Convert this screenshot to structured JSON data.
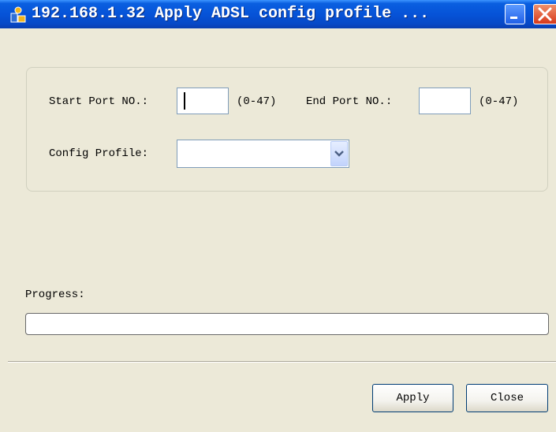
{
  "window": {
    "title": "192.168.1.32 Apply ADSL config profile ...",
    "icon": "app-icon",
    "minimize_icon": "minimize-icon",
    "close_icon": "close-icon"
  },
  "form": {
    "start_port_label": "Start Port NO.:",
    "start_port_value": "",
    "start_port_range": "(0-47)",
    "end_port_label": "End Port NO.:",
    "end_port_value": "",
    "end_port_range": "(0-47)",
    "profile_label": "Config Profile:",
    "profile_value": ""
  },
  "progress": {
    "label": "Progress:",
    "value": 0
  },
  "buttons": {
    "apply": "Apply",
    "close": "Close"
  }
}
